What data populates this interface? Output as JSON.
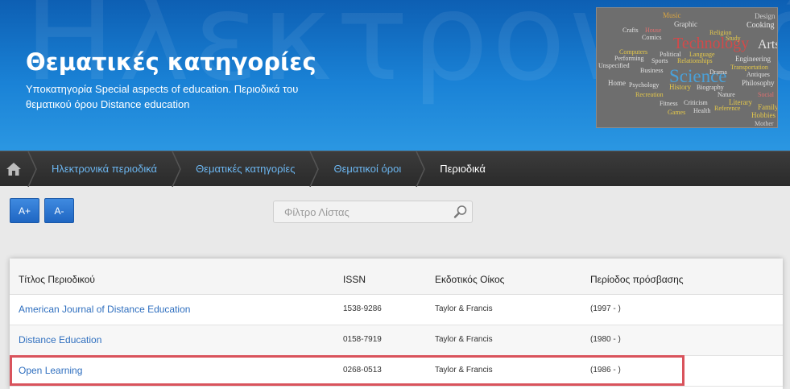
{
  "hero": {
    "bg_text": "Ηλεκτρονικά",
    "title": "Θεματικές κατηγορίες",
    "subtitle": "Υποκατηγορία Special aspects of education. Περιοδικά του θεματικού όρου Distance education"
  },
  "wordcloud": {
    "words": [
      "Music",
      "Design",
      "Cooking",
      "Graphic",
      "Crafts",
      "House",
      "Comics",
      "Technology",
      "Arts",
      "Computers",
      "Political",
      "Language",
      "Engineering",
      "Performing",
      "Sports",
      "Relationships",
      "Science",
      "Transportation",
      "Business",
      "Unspecified",
      "Home",
      "Psychology",
      "History",
      "Biography",
      "Philosophy",
      "Fitness",
      "Criticism",
      "Literary",
      "Family",
      "Games",
      "Health",
      "Reference",
      "Hobbies",
      "Mother",
      "Recreation",
      "Drama",
      "Religion",
      "Antiques",
      "Nature",
      "Study",
      "Social"
    ]
  },
  "breadcrumb": {
    "items": [
      {
        "label": "Ηλεκτρονικά περιοδικά"
      },
      {
        "label": "Θεματικές κατηγορίες"
      },
      {
        "label": "Θεματικοί όροι"
      },
      {
        "label": "Περιοδικά"
      }
    ]
  },
  "controls": {
    "font_increase": "A+",
    "font_decrease": "A-",
    "filter_placeholder": "Φίλτρο Λίστας"
  },
  "table": {
    "headers": [
      "Τίτλος Περιοδικού",
      "ISSN",
      "Εκδοτικός Οίκος",
      "Περίοδος πρόσβασης"
    ],
    "rows": [
      {
        "title": "American Journal of Distance Education",
        "issn": "1538-9286",
        "publisher": "Taylor & Francis",
        "period": "(1997 - )"
      },
      {
        "title": "Distance Education",
        "issn": "0158-7919",
        "publisher": "Taylor & Francis",
        "period": "(1980 - )"
      },
      {
        "title": "Open Learning",
        "issn": "0268-0513",
        "publisher": "Taylor & Francis",
        "period": "(1986 - )"
      }
    ]
  },
  "colors": {
    "accent": "#1f66c2",
    "link": "#2f6fbf",
    "highlight": "#d9535c"
  }
}
